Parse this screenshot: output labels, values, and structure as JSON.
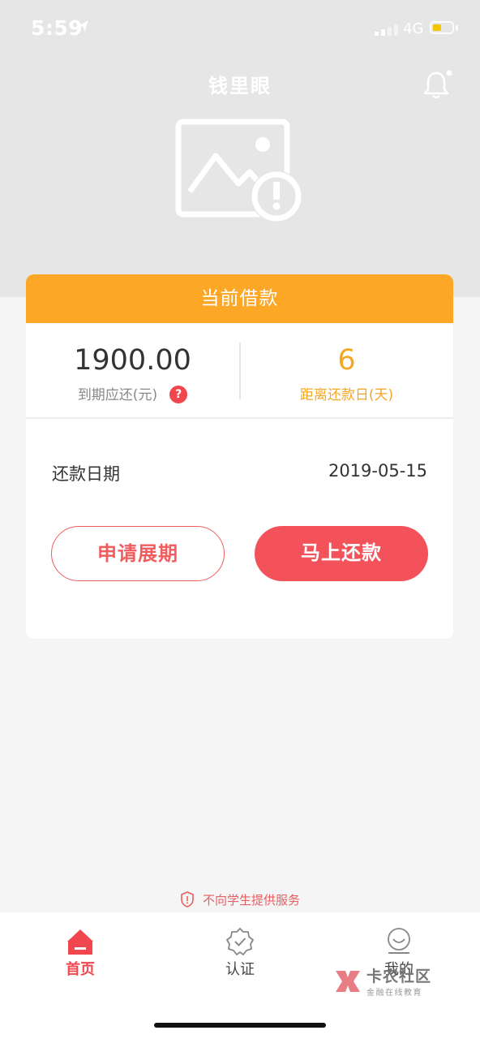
{
  "status_bar": {
    "time": "5:59",
    "network": "4G",
    "battery_level": 0.45
  },
  "header": {
    "title": "钱里眼"
  },
  "loan_card": {
    "header": "当前借款",
    "amount": "1900.00",
    "amount_label": "到期应还(元)",
    "help": "?",
    "days": "6",
    "days_label": "距离还款日(天)",
    "repay_date_label": "还款日期",
    "repay_date": "2019-05-15",
    "extend_button": "申请展期",
    "repay_button": "马上还款"
  },
  "notice": "不向学生提供服务",
  "tab_bar": {
    "items": [
      {
        "label": "首页",
        "active": true
      },
      {
        "label": "认证",
        "active": false
      },
      {
        "label": "我的",
        "active": false
      }
    ]
  },
  "watermark": {
    "title": "卡农社区",
    "subtitle": "金融在线教育"
  },
  "colors": {
    "accent_orange": "#fda727",
    "accent_red": "#f4525a"
  }
}
